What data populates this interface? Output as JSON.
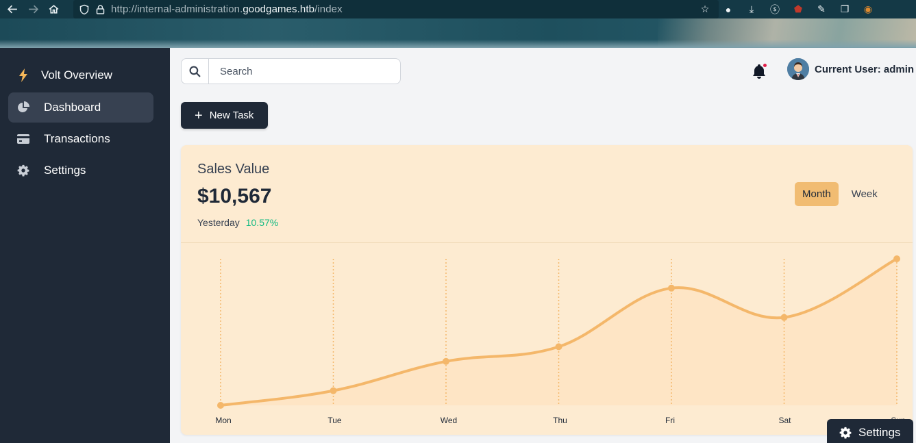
{
  "browser": {
    "url_prefix": "http://internal-administration.",
    "url_host": "goodgames.htb",
    "url_path": "/index"
  },
  "sidebar": {
    "brand": "Volt Overview",
    "items": [
      {
        "label": "Dashboard",
        "icon": "pie-chart-icon",
        "active": true
      },
      {
        "label": "Transactions",
        "icon": "credit-card-icon",
        "active": false
      },
      {
        "label": "Settings",
        "icon": "gear-icon",
        "active": false
      }
    ]
  },
  "header": {
    "search_placeholder": "Search",
    "user_label": "Current User: admin"
  },
  "actions": {
    "new_task": "New Task"
  },
  "sales": {
    "title": "Sales Value",
    "value": "$10,567",
    "period": "Yesterday",
    "change": "10.57%",
    "toggle": [
      "Month",
      "Week"
    ],
    "active_toggle": "Month"
  },
  "chart_data": {
    "type": "area",
    "categories": [
      "Mon",
      "Tue",
      "Wed",
      "Thu",
      "Fri",
      "Sat",
      "Sun"
    ],
    "series": [
      {
        "values": [
          0,
          10,
          30,
          40,
          80,
          60,
          100
        ]
      }
    ],
    "ylim": [
      0,
      100
    ],
    "colors": {
      "line": "#f4b76a",
      "fill": "#fde3c1",
      "grid": "#f4b76a"
    }
  },
  "settings_fab": "Settings"
}
